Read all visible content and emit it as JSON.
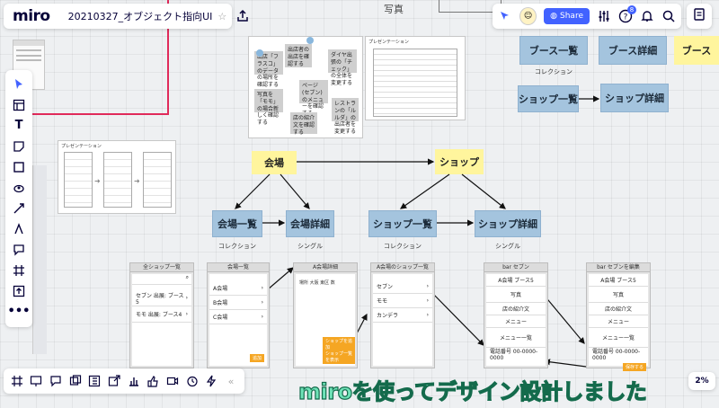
{
  "app": {
    "logo": "miro",
    "board_name": "20210327_オブジェクト指向UI"
  },
  "header": {
    "share_label": "Share",
    "notif_count": "8",
    "avatar_initial": "☺"
  },
  "zoom": "2%",
  "canvas": {
    "photo_label": "写真",
    "stickies": {
      "venue": "会場",
      "shop": "ショップ",
      "booth": "ブース"
    },
    "cards": {
      "booth_list": "ブース一覧",
      "booth_detail": "ブース詳細",
      "shop_list_top": "ショップ一覧",
      "shop_detail_top": "ショップ詳細",
      "venue_list": "会場一覧",
      "venue_detail": "会場詳細",
      "shop_list": "ショップ一覧",
      "shop_detail": "ショップ詳細"
    },
    "captions": {
      "booth_coll": "コレクション",
      "venue_coll": "コレクション",
      "venue_single": "シングル",
      "shop_coll": "コレクション",
      "shop_single": "シングル"
    },
    "presentation_label": "プレゼンテーション",
    "grey_notes": [
      "出店「フラスコ」のデータの場所を確認する",
      "出店者の出店を確認する",
      "ダイヤ出張の「チェック」の全体を変更する",
      "写真を「モモ」の場合新しく確認する",
      "ページ(セブン)のメニューを確認する",
      "レストランの「ルルダ」の出店者を変更する",
      "店の紹介文を確認する"
    ],
    "wireframes": {
      "all_shops": {
        "title": "全ショップ一覧",
        "rows": [
          "セブン 出展: ブース5",
          "モモ 出展: ブース4"
        ]
      },
      "venue_list": {
        "title": "会場一覧",
        "rows": [
          "A会場",
          "B会場",
          "C会場"
        ],
        "btn": "追加"
      },
      "venue_detail": {
        "title": "A会場詳細",
        "info": "場所 大阪 東区  数",
        "btn1": "ショップを追加",
        "btn2": "ショップ一覧を表示"
      },
      "venue_shops": {
        "title": "A会場のショップ一覧",
        "rows": [
          "セブン",
          "モモ",
          "カンデラ"
        ]
      },
      "shop_detail": {
        "title": "bar セブン",
        "rows": [
          "A会場  ブース5",
          "写真",
          "店の紹介文",
          "メニュー",
          "メニュー一覧",
          "電話番号 00-0000-0000"
        ]
      },
      "shop_edit": {
        "title": "bar セブンを編集",
        "rows": [
          "A会場  ブース5",
          "写真",
          "店の紹介文",
          "メニュー",
          "メニュー一覧",
          "電話番号 00-0000-0000"
        ],
        "btn": "保存する"
      }
    }
  },
  "banner": "miroを使ってデザイン設計しました"
}
